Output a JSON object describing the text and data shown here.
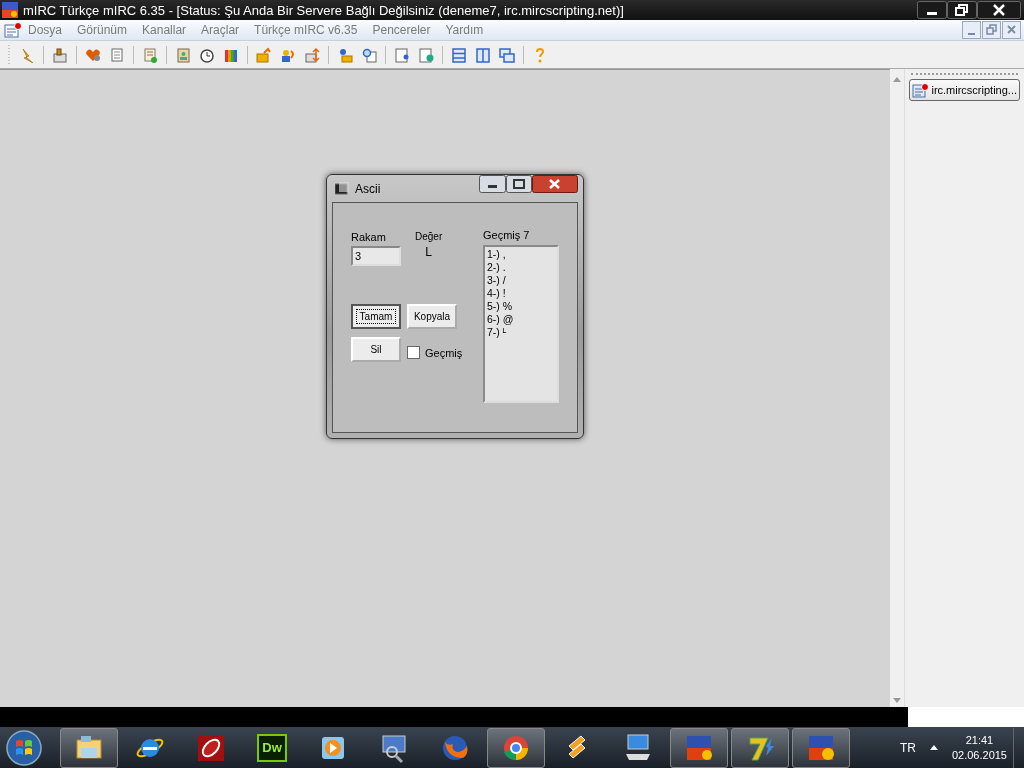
{
  "window": {
    "title": "mIRC Türkçe mIRC 6.35 - [Status: Şu Anda Bir Servere Bağlı Değilsiniz (deneme7, irc.mircscripting.net)]"
  },
  "menu": [
    "Dosya",
    "Görünüm",
    "Kanallar",
    "Araçlar",
    "Türkçe mIRC v6.35",
    "Pencereler",
    "Yardım"
  ],
  "switchbar": {
    "items": [
      {
        "label": "irc.mircscripting...",
        "selected": false
      }
    ]
  },
  "dialog": {
    "title": "Ascii",
    "rakam_label": "Rakam",
    "rakam_value": "3",
    "deger_label": "Değer",
    "deger_value": "L",
    "history_label": "Geçmiş 7",
    "history": [
      "1-) ,",
      "2-) .",
      "3-) /",
      "4-) !",
      "5-) %",
      "6-) @",
      "7-) ᴸ"
    ],
    "buttons": [
      {
        "label": "Tamam",
        "focused": true
      },
      {
        "label": "Kopyala",
        "focused": false
      }
    ],
    "delete_button": "Sil",
    "checkbox": {
      "label": "Geçmiş",
      "checked": false
    }
  },
  "taskbar": {
    "apps": [
      {
        "open": true
      },
      {
        "open": false
      },
      {
        "open": false
      },
      {
        "open": false,
        "logo": "Dw"
      },
      {
        "open": false
      },
      {
        "open": false
      },
      {
        "open": false
      },
      {
        "open": true
      },
      {
        "open": false
      },
      {
        "open": false
      },
      {
        "open": true
      },
      {
        "open": true
      },
      {
        "open": true
      }
    ],
    "language": "TR",
    "time": "21:41",
    "date": "02.06.2015"
  }
}
